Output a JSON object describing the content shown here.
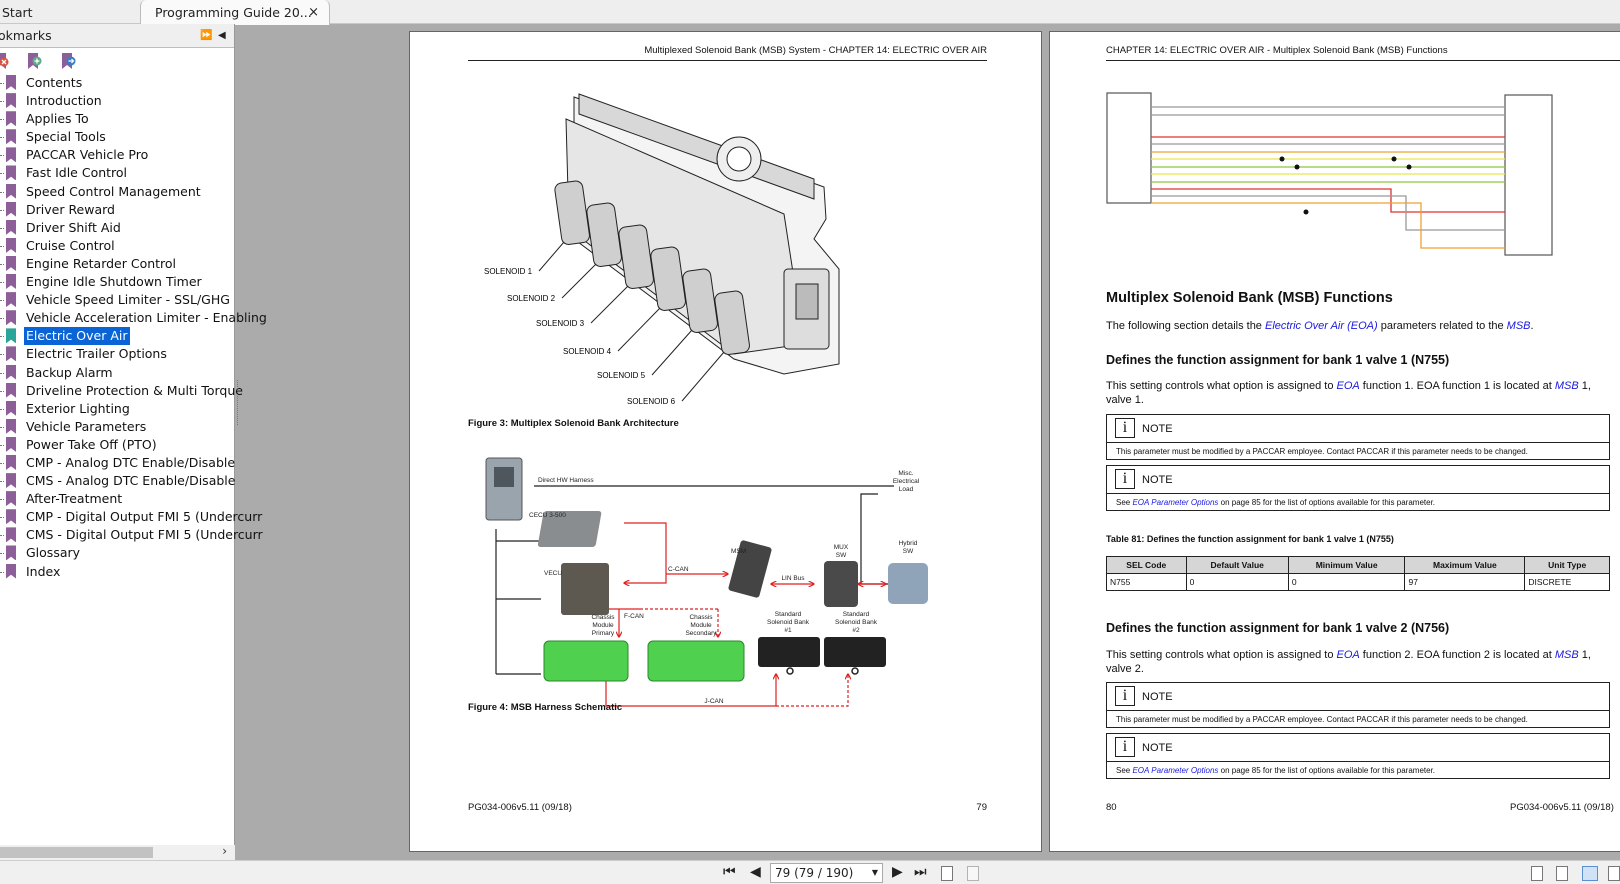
{
  "tabs": [
    {
      "label": "Start"
    },
    {
      "label": "Programming Guide 20...",
      "close": "×"
    }
  ],
  "sidebar": {
    "title": "okmarks",
    "expand_icon": "⏩",
    "collapse_icon": "◀",
    "items": [
      {
        "label": "Contents"
      },
      {
        "label": "Introduction"
      },
      {
        "label": "Applies To"
      },
      {
        "label": "Special Tools"
      },
      {
        "label": "PACCAR Vehicle Pro"
      },
      {
        "label": "Fast Idle Control"
      },
      {
        "label": "Speed Control Management"
      },
      {
        "label": "Driver Reward"
      },
      {
        "label": "Driver Shift Aid"
      },
      {
        "label": "Cruise Control"
      },
      {
        "label": "Engine Retarder Control"
      },
      {
        "label": "Engine Idle Shutdown Timer"
      },
      {
        "label": "Vehicle Speed Limiter - SSL/GHG"
      },
      {
        "label": "Vehicle Acceleration Limiter - Enabling"
      },
      {
        "label": "Electric Over Air",
        "selected": true
      },
      {
        "label": "Electric Trailer Options"
      },
      {
        "label": "Backup Alarm"
      },
      {
        "label": "Driveline Protection & Multi Torque"
      },
      {
        "label": "Exterior Lighting"
      },
      {
        "label": "Vehicle Parameters"
      },
      {
        "label": "Power Take Off (PTO)"
      },
      {
        "label": "CMP - Analog DTC Enable/Disable"
      },
      {
        "label": "CMS - Analog DTC Enable/Disable"
      },
      {
        "label": "After-Treatment"
      },
      {
        "label": "CMP - Digital Output FMI 5 (Undercurr"
      },
      {
        "label": "CMS - Digital Output FMI 5 (Undercurr"
      },
      {
        "label": "Glossary"
      },
      {
        "label": "Index"
      }
    ],
    "scroll_right": "›"
  },
  "left_page": {
    "header": "Multiplexed Solenoid Bank (MSB) System - CHAPTER 14: ELECTRIC OVER AIR",
    "solenoids": [
      "SOLENOID 1",
      "SOLENOID 2",
      "SOLENOID 3",
      "SOLENOID 4",
      "SOLENOID 5",
      "SOLENOID 6"
    ],
    "figure3_caption": "Figure 3: Multiplex Solenoid Bank Architecture",
    "schematic": {
      "direct_hw": "Direct HW Harness",
      "misc": [
        "Misc.",
        "Electrical",
        "Load"
      ],
      "cecu": "CECU 3-500",
      "vecu": "VECU",
      "ccan": "C-CAN",
      "msm": "MSM",
      "lin": "LIN Bus",
      "mux": [
        "MUX",
        "SW"
      ],
      "hybrid": [
        "Hybrid",
        "SW"
      ],
      "fcan": "F-CAN",
      "cm_primary": [
        "Chassis",
        "Module",
        "Primary"
      ],
      "cm_secondary": [
        "Chassis",
        "Module",
        "Secondary"
      ],
      "ssb1": [
        "Standard",
        "Solenoid Bank",
        "#1"
      ],
      "ssb2": [
        "Standard",
        "Solenoid Bank",
        "#2"
      ],
      "jcan": "J-CAN"
    },
    "figure4_caption": "Figure 4: MSB Harness Schematic",
    "footer_left": "PG034-006v5.11 (09/18)",
    "footer_page": "79"
  },
  "right_page": {
    "header": "CHAPTER 14: ELECTRIC OVER AIR - Multiplex Solenoid Bank (MSB) Functions",
    "title": "Multiplex Solenoid Bank (MSB) Functions",
    "intro": {
      "pre": "The following section details the ",
      "link1": "Electric Over Air (EOA)",
      "mid": " parameters related to the ",
      "link2": "MSB",
      "post": "."
    },
    "sections": [
      {
        "heading": "Defines the function assignment for bank 1 valve 1 (N755)",
        "text": {
          "pre": "This setting controls what option is assigned to ",
          "link1": "EOA",
          "mid": " function 1. EOA function 1 is located at ",
          "link2": "MSB",
          "post": " 1, valve 1."
        }
      },
      {
        "heading": "Defines the function assignment for bank 1 valve 2 (N756)",
        "text": {
          "pre": "This setting controls what option is assigned to ",
          "link1": "EOA",
          "mid": " function 2. EOA function 2 is located at ",
          "link2": "MSB",
          "post": " 1, valve 2."
        }
      }
    ],
    "note_label": "NOTE",
    "note_icon": "i",
    "note_employee": "This parameter must be modified by a PACCAR employee. Contact PACCAR if this parameter needs to be changed.",
    "note_options": {
      "pre": "See ",
      "link": "EOA Parameter Options",
      "post": " on page 85 for the list of options available for this parameter."
    },
    "table_caption": "Table 81: Defines the function assignment for bank 1 valve 1 (N755)",
    "table": {
      "headers": [
        "SEL Code",
        "Default Value",
        "Minimum Value",
        "Maximum Value",
        "Unit Type"
      ],
      "row": [
        "N755",
        "0",
        "0",
        "97",
        "DISCRETE"
      ]
    },
    "footer_page": "80",
    "footer_right": "PG034-006v5.11 (09/18)"
  },
  "toolbar": {
    "first": "⏮",
    "prev": "◀",
    "page_value": "79 (79 / 190)",
    "next": "▶",
    "last": "⏭"
  },
  "colors": {
    "selection": "#0a64d6",
    "link": "#1a1adf",
    "bookmark": "#8c5f98"
  }
}
